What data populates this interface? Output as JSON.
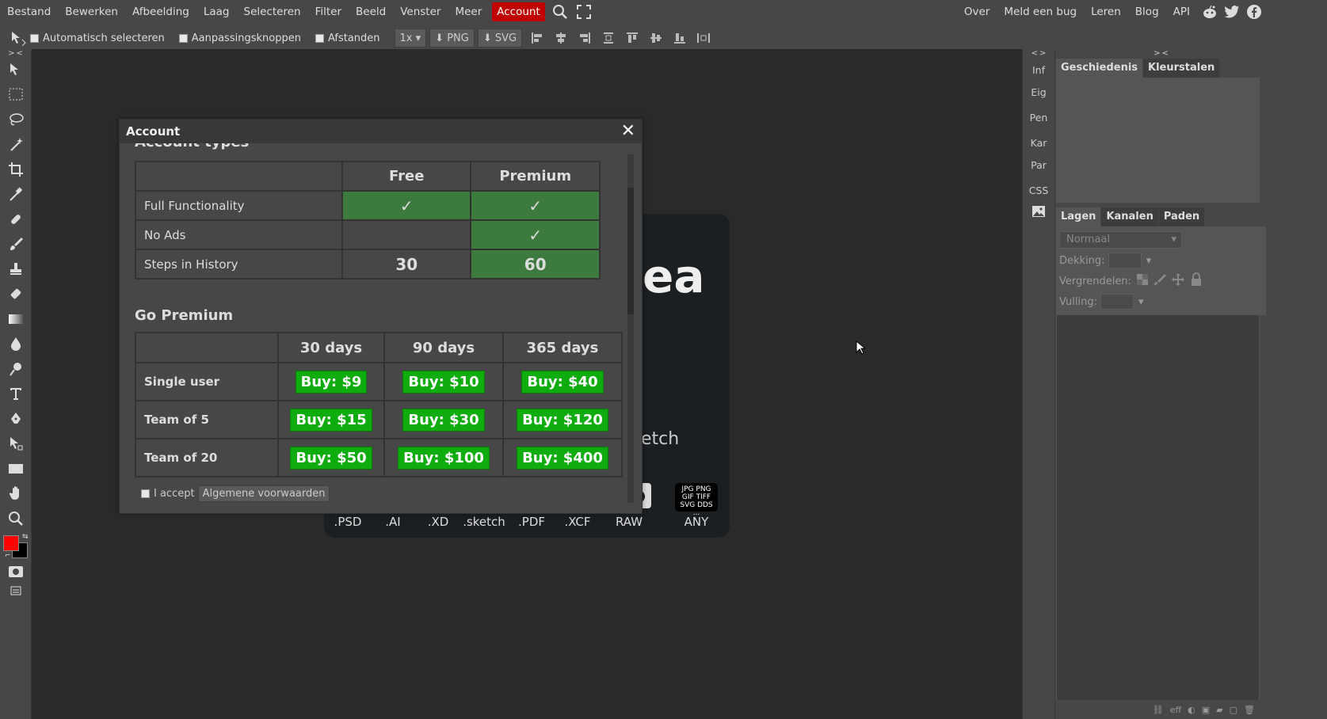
{
  "menu": {
    "items": [
      "Bestand",
      "Bewerken",
      "Afbeelding",
      "Laag",
      "Selecteren",
      "Filter",
      "Beeld",
      "Venster",
      "Meer",
      "Account"
    ],
    "active": "Account",
    "right_items": [
      "Over",
      "Meld een bug",
      "Leren",
      "Blog",
      "API"
    ]
  },
  "options": {
    "auto_select": "Automatisch selecteren",
    "transform_controls": "Aanpassingsknoppen",
    "distances": "Afstanden",
    "zoom": "1x",
    "png": "PNG",
    "svg": "SVG"
  },
  "tools": {
    "toggle": "> <"
  },
  "side_tabs": {
    "toggle": "< >",
    "items": [
      "Inf",
      "Eig",
      "Pen",
      "Kar",
      "Par",
      "CSS"
    ]
  },
  "panel": {
    "toggle": "> <",
    "top_tabs": [
      "Geschiedenis",
      "Kleurstalen"
    ],
    "layer_tabs": [
      "Lagen",
      "Kanalen",
      "Paden"
    ],
    "blend_mode": "Normaal",
    "opacity_label": "Dekking:",
    "lock_label": "Vergrendelen:",
    "fill_label": "Vulling:",
    "footer": [
      "eff"
    ]
  },
  "splash": {
    "big": "ea",
    "sketch_partial": "etch",
    "formats": [
      ".PSD",
      ".AI",
      ".XD",
      ".sketch",
      ".PDF",
      ".XCF",
      "RAW",
      "ANY"
    ],
    "any_badge": [
      "JPG PNG",
      "GIF TIFF",
      "SVG DDS",
      "..."
    ]
  },
  "dialog": {
    "title": "Account",
    "section1_partial": "Account types",
    "account_types": {
      "headers": [
        "",
        "Free",
        "Premium"
      ],
      "rows": [
        {
          "label": "Full Functionality",
          "free": "✓",
          "premium": "✓"
        },
        {
          "label": "No Ads",
          "free": "",
          "premium": "✓"
        },
        {
          "label": "Steps in History",
          "free": "30",
          "premium": "60"
        }
      ]
    },
    "section2": "Go Premium",
    "premium": {
      "headers": [
        "",
        "30 days",
        "90 days",
        "365 days"
      ],
      "rows": [
        {
          "label": "Single user",
          "prices": [
            "Buy: $9",
            "Buy: $10",
            "Buy: $40"
          ]
        },
        {
          "label": "Team of 5",
          "prices": [
            "Buy: $15",
            "Buy: $30",
            "Buy: $120"
          ]
        },
        {
          "label": "Team of 20",
          "prices": [
            "Buy: $50",
            "Buy: $100",
            "Buy: $400"
          ]
        }
      ]
    },
    "accept_label": "I accept",
    "terms_button": "Algemene voorwaarden"
  },
  "colors": {
    "foreground": "#ff0000",
    "background": "#000000",
    "accent": "#c00000",
    "buy": "#0eac0e",
    "included": "#3d7a3d"
  }
}
